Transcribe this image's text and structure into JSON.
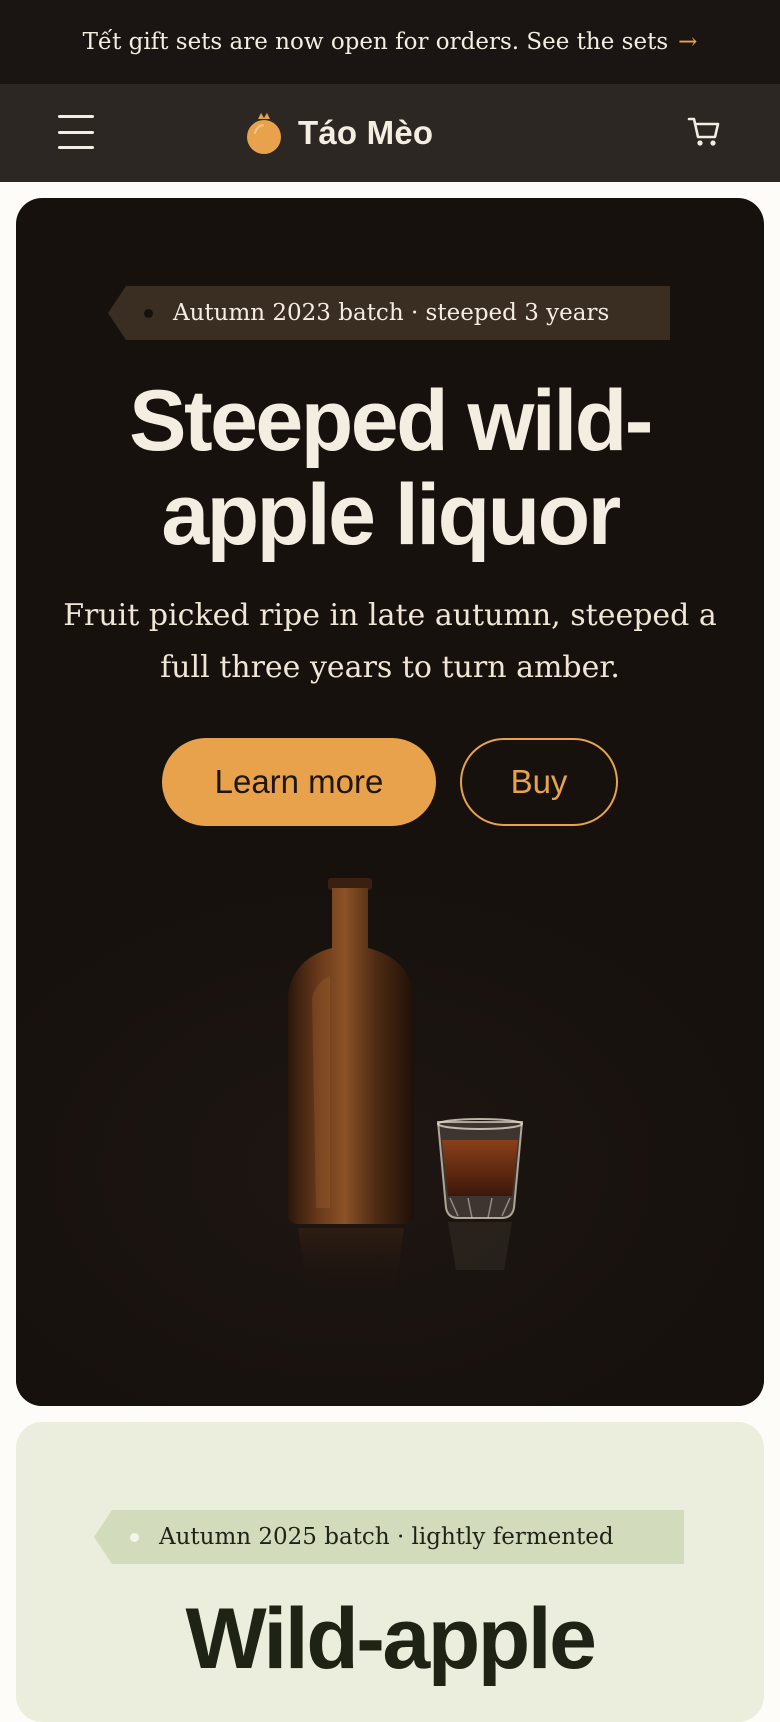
{
  "announcement": {
    "text": "Tết gift sets are now open for orders. See the sets",
    "arrow": "→"
  },
  "header": {
    "menu_icon": "hamburger-menu-icon",
    "logo_icon": "apple-logo-icon",
    "brand": "Táo Mèo",
    "cart_icon": "shopping-cart-icon"
  },
  "hero": {
    "tag": "Autumn 2023 batch · steeped 3 years",
    "title_line1": "Steeped wild-",
    "title_line2": "apple liquor",
    "subtitle_line1": "Fruit picked ripe in late autumn, steeped a",
    "subtitle_line2": "full three years to turn amber.",
    "primary_button": "Learn more",
    "secondary_button": "Buy"
  },
  "second_card": {
    "tag": "Autumn 2025 batch · lightly fermented",
    "title": "Wild-apple"
  },
  "colors": {
    "accent": "#e8a24c",
    "dark_bg": "#17110e",
    "light_bg": "#eceedd"
  }
}
